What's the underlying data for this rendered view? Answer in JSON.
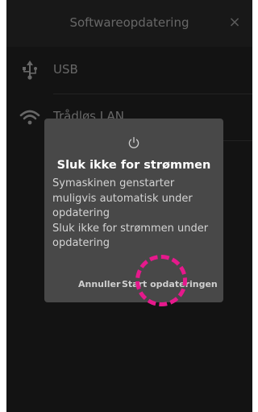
{
  "header": {
    "title": "Softwareopdatering",
    "close_label": "×",
    "close_icon": "close-icon"
  },
  "menu": [
    {
      "icon": "usb-icon",
      "label": "USB"
    },
    {
      "icon": "wifi-icon",
      "label": "Trådløs LAN"
    }
  ],
  "dialog": {
    "icon": "power-icon",
    "title": "Sluk ikke for strømmen",
    "message_1": "Symaskinen genstarter muligvis automatisk under opdatering",
    "message_2": "Sluk ikke for strømmen under opdatering",
    "cancel_label": "Annuller",
    "start_label": "Start opdateringen"
  },
  "colors": {
    "background": "#1a1a1a",
    "dialog": "#484848",
    "tap_highlight": "#e6198c"
  }
}
